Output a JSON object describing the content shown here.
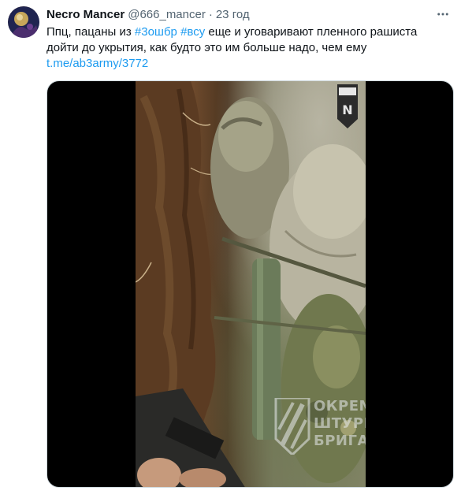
{
  "tweet": {
    "display_name": "Necro Mancer",
    "handle": "@666_mancer",
    "separator": "·",
    "time": "23 год",
    "text": {
      "line1_before": "Ппц, пацаны из ",
      "hashtag1": "#3ошбр",
      "between": " ",
      "hashtag2": "#всу",
      "line1_after": " еще и уговаривают пленного рашиста",
      "line2": "дойти до укрытия, как будто это им больше надо, чем ему",
      "link": "t.me/ab3army/3772"
    }
  },
  "media": {
    "badge_letter": "N",
    "watermark": {
      "line1": "ОКРЕМА",
      "line2": "ШТУРМОВА",
      "line3": "БРИГАДА"
    }
  },
  "icons": {
    "more": "more-horizontal-icon",
    "avatar": "avatar-image",
    "logo": "brigade-logo"
  },
  "colors": {
    "text": "#0f1419",
    "secondary": "#536471",
    "link": "#1d9bf0"
  }
}
